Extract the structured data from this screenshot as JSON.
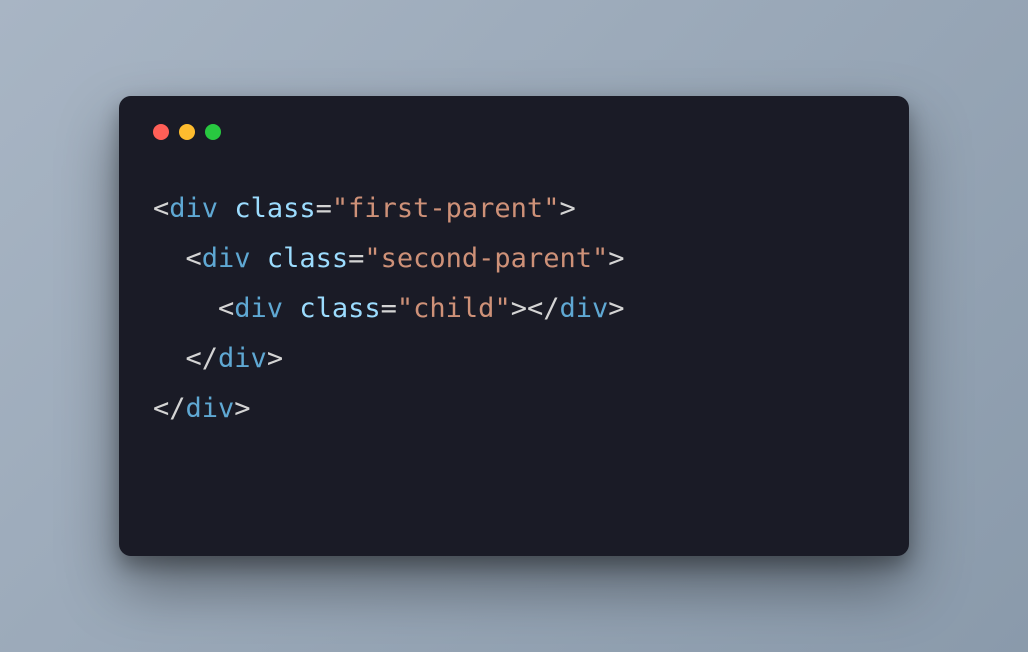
{
  "code": {
    "lines": [
      {
        "indent": 0,
        "type": "open",
        "tag": "div",
        "attr": "class",
        "value": "first-parent"
      },
      {
        "indent": 1,
        "type": "open",
        "tag": "div",
        "attr": "class",
        "value": "second-parent"
      },
      {
        "indent": 2,
        "type": "openclose",
        "tag": "div",
        "attr": "class",
        "value": "child"
      },
      {
        "indent": 1,
        "type": "close",
        "tag": "div"
      },
      {
        "indent": 0,
        "type": "close",
        "tag": "div"
      }
    ]
  },
  "syntax": {
    "lt": "<",
    "gt": ">",
    "lt_slash": "</",
    "eq": "=",
    "quote": "\""
  }
}
